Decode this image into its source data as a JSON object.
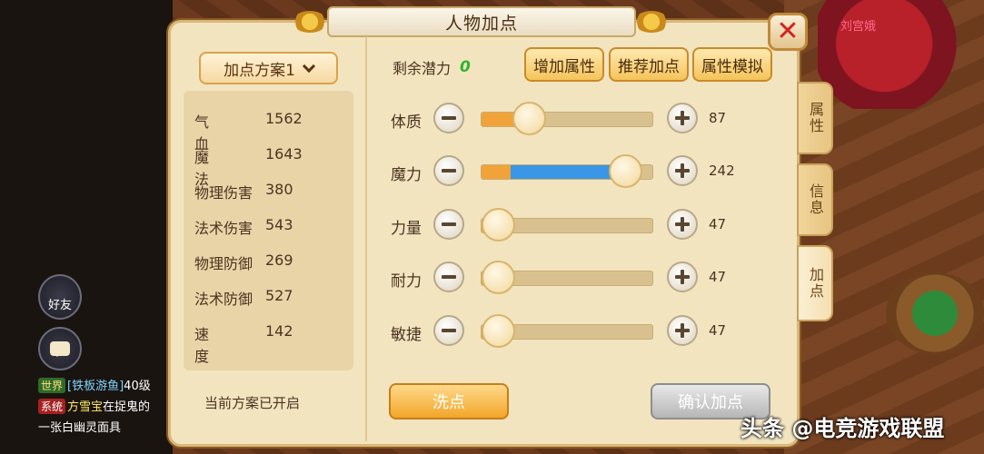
{
  "background": {
    "npc_name": "刘宫娥",
    "side_hud": {
      "friend_label": "好友"
    },
    "chat": [
      {
        "tag": "世界",
        "name": "[铁板游鱼]",
        "text": "40级"
      },
      {
        "tag": "系统",
        "name": "方雪宝",
        "text": "在捉鬼的"
      },
      {
        "tag": "",
        "name": "",
        "text": "一张白幽灵面具"
      }
    ]
  },
  "dialog": {
    "title": "人物加点",
    "close_icon": "close-x-icon",
    "plan_select": {
      "value": "加点方案1"
    },
    "stats": [
      {
        "name": "气血",
        "value": "1562"
      },
      {
        "name": "魔法",
        "value": "1643"
      },
      {
        "name": "物理伤害",
        "value": "380"
      },
      {
        "name": "法术伤害",
        "value": "543"
      },
      {
        "name": "物理防御",
        "value": "269"
      },
      {
        "name": "法术防御",
        "value": "527"
      },
      {
        "name": "速度",
        "value": "142"
      }
    ],
    "current_plan_text": "当前方案已开启",
    "remaining_label": "剩余潜力",
    "remaining_value": "0",
    "top_buttons": {
      "add_attr": "增加属性",
      "recommend": "推荐加点",
      "simulate": "属性模拟"
    },
    "attributes": [
      {
        "label": "体质",
        "value": "87",
        "base_fraction": 0.22,
        "added_fraction": 0.06
      },
      {
        "label": "魔力",
        "value": "242",
        "base_fraction": 0.17,
        "added_fraction": 0.67
      },
      {
        "label": "力量",
        "value": "47",
        "base_fraction": 0.1,
        "added_fraction": 0.0
      },
      {
        "label": "耐力",
        "value": "47",
        "base_fraction": 0.1,
        "added_fraction": 0.0
      },
      {
        "label": "敏捷",
        "value": "47",
        "base_fraction": 0.1,
        "added_fraction": 0.0
      }
    ],
    "bottom_buttons": {
      "wash": "洗点",
      "confirm": "确认加点"
    },
    "side_tabs": [
      {
        "label": "属性",
        "active": false
      },
      {
        "label": "信息",
        "active": false
      },
      {
        "label": "加点",
        "active": true
      }
    ],
    "colors": {
      "base_fill": "#f1a33a",
      "added_fill": "#3a96e6",
      "remaining_value": "#2db52d",
      "close_x": "#d12222"
    }
  },
  "watermark": "头条 @电竞游戏联盟"
}
